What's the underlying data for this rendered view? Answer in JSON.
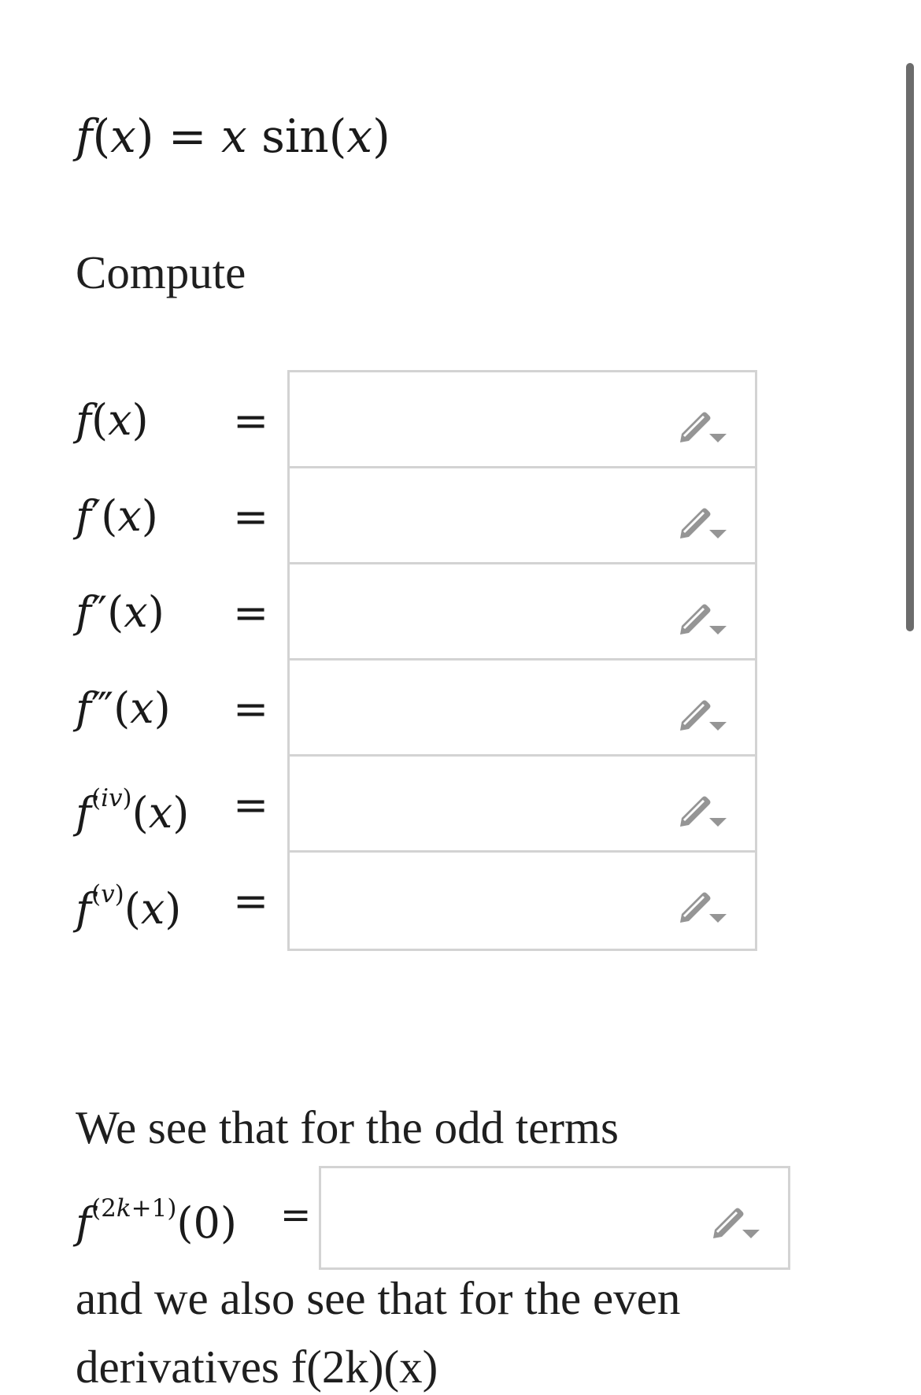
{
  "problem": {
    "function_definition": "f(x) = x sin(x)",
    "instruction": "Compute",
    "odd_terms_text": "We see that for the odd terms",
    "even_terms_text": "and we also see that for the even",
    "truncated_text": "derivatives f(2k)(x)"
  },
  "derivatives": [
    {
      "label": "f(x)",
      "symbol": "=",
      "value": ""
    },
    {
      "label": "f′(x)",
      "symbol": "=",
      "value": ""
    },
    {
      "label": "f″(x)",
      "symbol": "=",
      "value": ""
    },
    {
      "label": "f‴(x)",
      "symbol": "=",
      "value": ""
    },
    {
      "label": "f(iv)(x)",
      "symbol": "=",
      "value": ""
    },
    {
      "label": "f(v)(x)",
      "symbol": "=",
      "value": ""
    }
  ],
  "odd_answer": {
    "label": "f(2k+1)(0)",
    "symbol": "=",
    "value": ""
  },
  "icons": {
    "edit": "pencil-dropdown-icon",
    "scroll": "vertical-scrollbar"
  },
  "colors": {
    "text": "#1a1a1a",
    "box_border": "#d3d3d3",
    "icon": "#959595",
    "scrollbar": "#6c6c6c"
  }
}
